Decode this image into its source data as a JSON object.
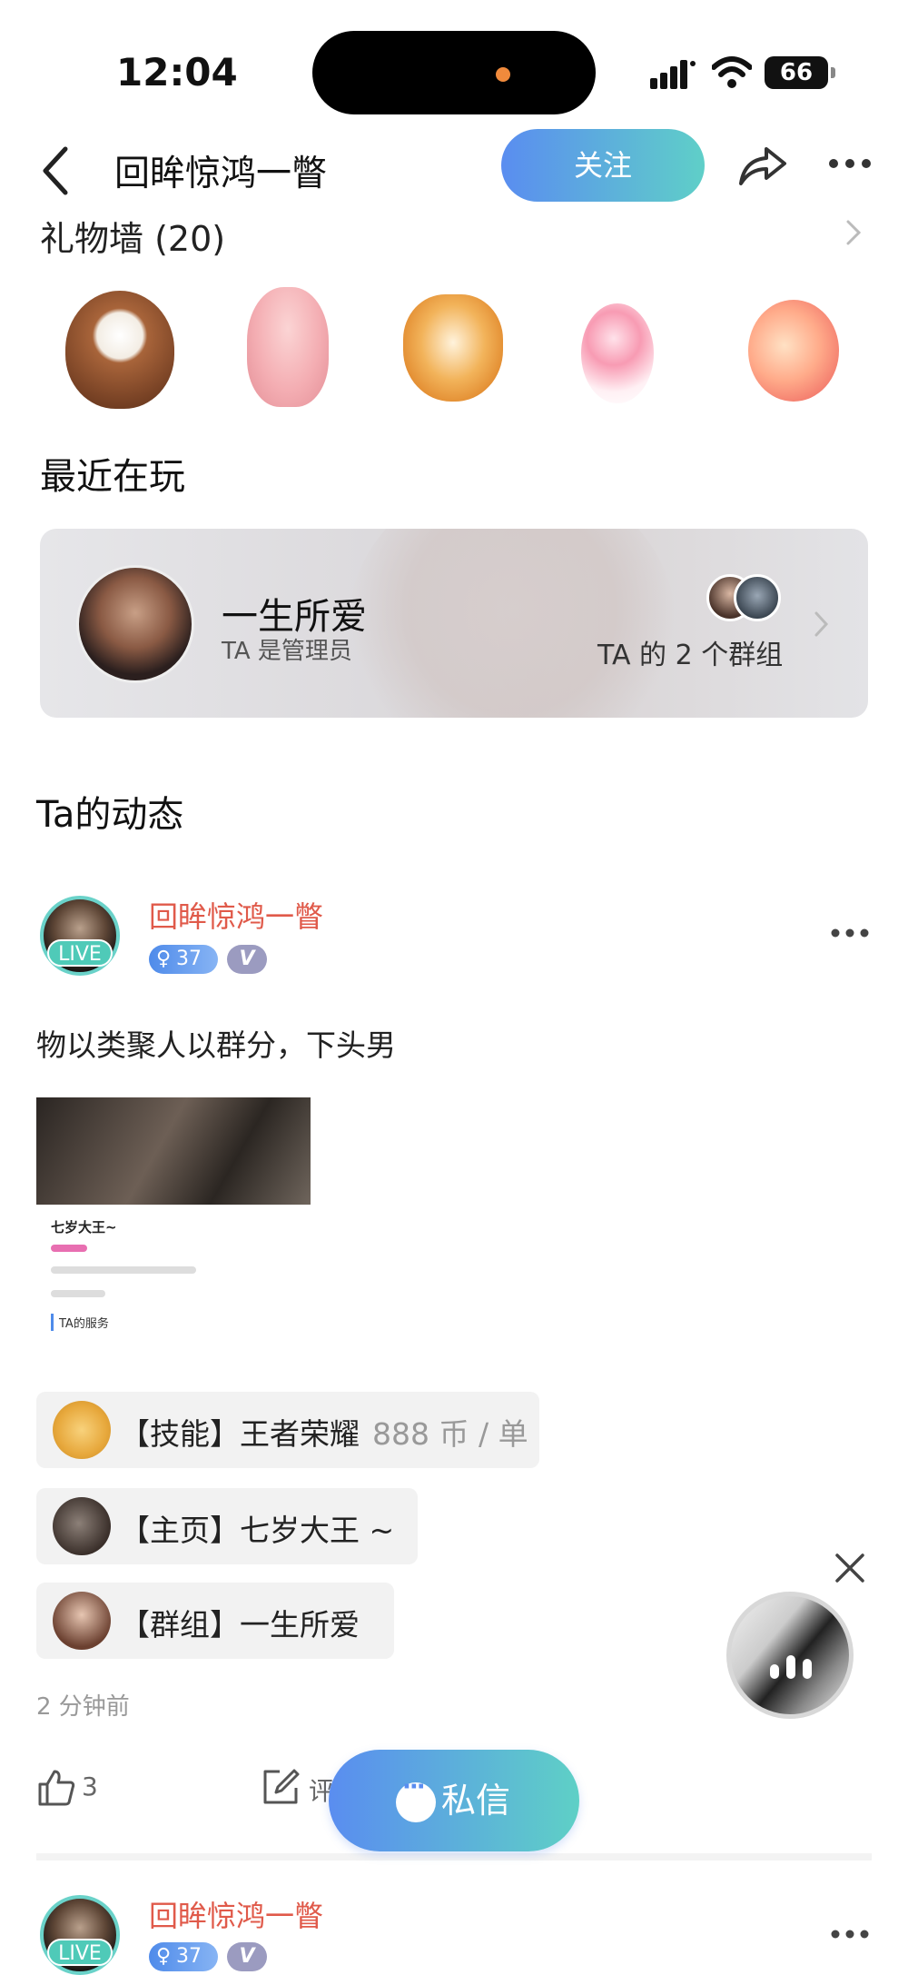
{
  "status_bar": {
    "time": "12:04",
    "battery": "66"
  },
  "header": {
    "title": "回眸惊鸿一瞥",
    "follow_label": "关注"
  },
  "gift_wall": {
    "title": "礼物墙 (20)",
    "gifts": [
      "coconut",
      "pig",
      "corgi",
      "lollipop-wand",
      "peach"
    ]
  },
  "recent": {
    "title": "最近在玩",
    "group_name": "一生所爱",
    "role": "TA 是管理员",
    "groups_text": "TA 的 2 个群组"
  },
  "dynamics": {
    "title": "Ta的动态"
  },
  "posts": [
    {
      "author": "回眸惊鸿一瞥",
      "live": "LIVE",
      "level": "37",
      "v": "V",
      "text": "物以类聚人以群分，下头男",
      "image_card": {
        "name": "七岁大王~",
        "service_label": "TA的服务"
      },
      "chips": [
        {
          "label": "【技能】王者荣耀",
          "price": "888 币 / 单"
        },
        {
          "label": "【主页】七岁大王 ~"
        },
        {
          "label": "【群组】一生所爱"
        }
      ],
      "time_ago": "2 分钟前",
      "likes": "3",
      "comment_label": "评"
    },
    {
      "author": "回眸惊鸿一瞥",
      "live": "LIVE",
      "level": "37",
      "v": "V"
    }
  ],
  "dm_button": {
    "label": "私信"
  },
  "colors": {
    "accent_gradient_start": "#5a8df0",
    "accent_gradient_end": "#5fcfc8",
    "author_name": "#e05a4a",
    "live_badge": "#4fcab8"
  }
}
